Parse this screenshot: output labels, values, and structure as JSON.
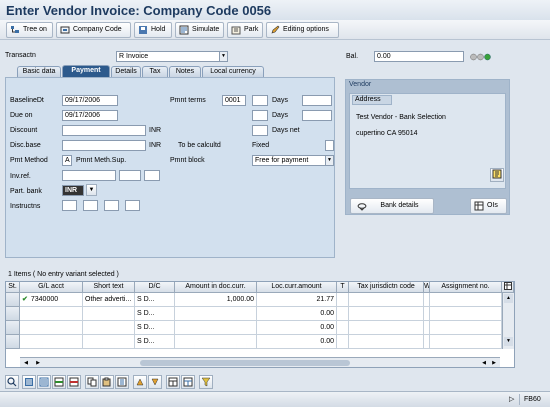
{
  "window": {
    "title": "Enter Vendor Invoice: Company Code 0056"
  },
  "toolbar": {
    "tree_on": "Tree on",
    "company_code": "Company Code",
    "hold": "Hold",
    "simulate": "Simulate",
    "park": "Park",
    "editing_options": "Editing options"
  },
  "header": {
    "transactn_label": "Transactn",
    "transactn_value": "R  Invoice",
    "bal_label": "Bal.",
    "bal_value": "0.00"
  },
  "tabs": [
    "Basic data",
    "Payment",
    "Details",
    "Tax",
    "Notes",
    "Local currency"
  ],
  "payment": {
    "baselinedt_label": "BaselineDt",
    "baselinedt_value": "09/17/2006",
    "dueon_label": "Due on",
    "dueon_value": "09/17/2006",
    "discount_label": "Discount",
    "discount_currency": "INR",
    "discbase_label": "Disc.base",
    "discbase_currency": "INR",
    "pmtmethod_label": "Pmt Method",
    "pmtmethod_value": "A",
    "pmtmethod_text": "Pmnt Meth.Sup.",
    "invref_label": "Inv.ref.",
    "partbank_label": "Part. bank",
    "partbank_value": "INR",
    "instructns_label": "Instructns",
    "pmnt_terms_label": "Pmnt terms",
    "pmnt_terms_value": "0001",
    "days_label1": "Days",
    "days_label2": "Days",
    "days_net_label": "Days net",
    "to_be_calc_label": "To be calcultd",
    "fixed_label": "Fixed",
    "pmnt_block_label": "Pmnt block",
    "pmnt_block_value": "Free for payment"
  },
  "vendor": {
    "box_title": "Vendor",
    "address_title": "Address",
    "name": "Test Vendor - Bank Selection",
    "city_line": "cupertino CA  95014",
    "bank_details": "Bank details",
    "ois": "OIs"
  },
  "items": {
    "caption": "1 Items ( No entry variant selected )",
    "columns": [
      "St.",
      "G/L acct",
      "Short text",
      "D/C",
      "Amount in doc.curr.",
      "Loc.curr.amount",
      "T",
      "Tax jurisdictn code",
      "W",
      "Assignment no."
    ],
    "rows": [
      {
        "gl": "7340000",
        "short": "Other adverti...",
        "dc": "S  D...",
        "amount": "1,000.00",
        "loc": "21.77"
      },
      {
        "gl": "",
        "short": "",
        "dc": "S  D...",
        "amount": "",
        "loc": "0.00"
      },
      {
        "gl": "",
        "short": "",
        "dc": "S  D...",
        "amount": "",
        "loc": "0.00"
      },
      {
        "gl": "",
        "short": "",
        "dc": "S  D...",
        "amount": "",
        "loc": "0.00"
      }
    ]
  },
  "status": {
    "tcode": "FB60"
  },
  "colors": {
    "title": "#1d3a5f",
    "active_tab": "#2d5a8c",
    "panel": "#d2e0ee",
    "ok_check": "#2e8b2e"
  }
}
